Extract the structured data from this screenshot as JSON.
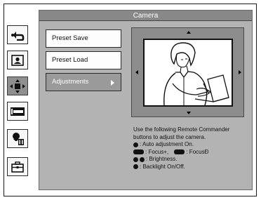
{
  "window": {
    "title": "Camera"
  },
  "rail": {
    "items": [
      {
        "id": "back",
        "icon": "back-arrow-icon",
        "active": false
      },
      {
        "id": "preset",
        "icon": "portrait-icon",
        "active": false
      },
      {
        "id": "pan-tilt",
        "icon": "pan-tilt-icon",
        "active": true
      },
      {
        "id": "card",
        "icon": "memory-card-icon",
        "active": false
      },
      {
        "id": "camera-setup",
        "icon": "camera-setup-icon",
        "active": false
      },
      {
        "id": "toolbox",
        "icon": "toolbox-icon",
        "active": false
      }
    ]
  },
  "menu": {
    "items": [
      {
        "label": "Preset Save",
        "active": false
      },
      {
        "label": "Preset Load",
        "active": false
      },
      {
        "label": "Adjustments",
        "active": true,
        "has_submenu": true
      }
    ]
  },
  "help": {
    "intro1": "Use the following Remote Commander",
    "intro2": "buttons to adjust the camera.",
    "auto": ": Auto adjustment On.",
    "focus_plus": ": Focus+,",
    "focus_minus": ": FocusÐ",
    "brightness": ": Brightness.",
    "backlight": ": Backlight On/Off."
  },
  "colors": {
    "window_bg": "#b3b3b3",
    "titlebar": "#888888",
    "active_item": "#9a9a9a"
  }
}
